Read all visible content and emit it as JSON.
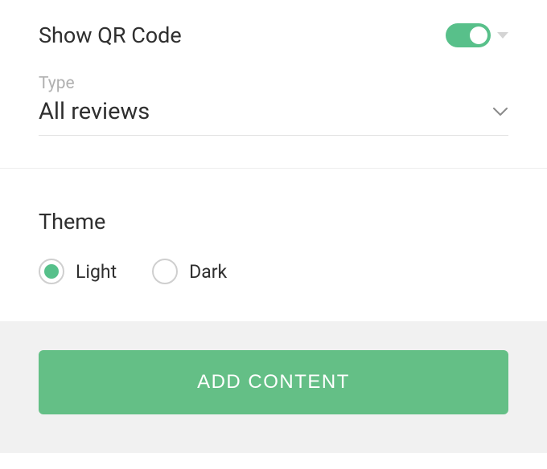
{
  "qr": {
    "label": "Show QR Code",
    "enabled": true
  },
  "type_field": {
    "label": "Type",
    "value": "All reviews"
  },
  "theme": {
    "heading": "Theme",
    "options": [
      {
        "label": "Light",
        "selected": true
      },
      {
        "label": "Dark",
        "selected": false
      }
    ]
  },
  "button": {
    "add_content": "ADD CONTENT"
  },
  "colors": {
    "accent": "#58c08a",
    "button": "#64bf86"
  }
}
